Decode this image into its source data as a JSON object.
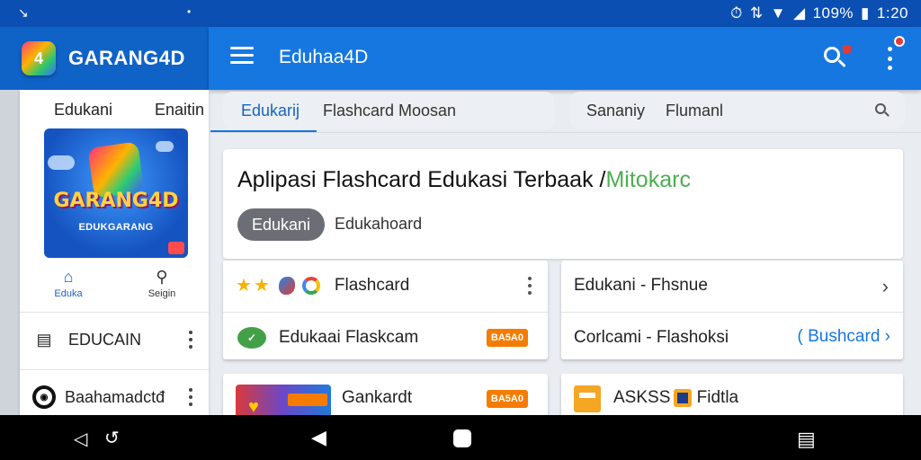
{
  "status_bar": {
    "left_glyph": "↘",
    "center_glyph": "•",
    "battery": "109%",
    "time": "1:20"
  },
  "brand": {
    "name": "GARANG4D"
  },
  "appbar": {
    "title": "Eduhaa4D"
  },
  "left_panel": {
    "tabs": [
      "Edukani",
      "Enaitin"
    ],
    "hero": {
      "title": "GARANG4D",
      "subtitle": "EDUKGARANG"
    },
    "nav": [
      {
        "label": "Eduka",
        "icon": "home-icon"
      },
      {
        "label": "Seigin",
        "icon": "search-icon"
      }
    ],
    "items": [
      {
        "label": "EDUCAIN",
        "icon": "screen-icon"
      },
      {
        "label": "Baahamadctđ",
        "icon": "ring-icon"
      }
    ]
  },
  "tabs": {
    "active": "Edukarij",
    "second": "Flashcard Moosan"
  },
  "filter": {
    "a": "Sananiy",
    "b": "Flumanl"
  },
  "headline": {
    "title": "Aplipasi Flashcard Edukasi Terbaak /",
    "accent": "Μitokarc",
    "chip": "Edukani",
    "chip_secondary": "Edukahoard"
  },
  "cards": [
    {
      "label": "Flashcard",
      "icons": [
        "star-icon",
        "star-icon",
        "blob-icon",
        "ring-color-icon"
      ]
    },
    {
      "label": "Edukaai Flaskcam",
      "badge": "BA5A0",
      "icon": "leaf-icon"
    },
    {
      "label": "Edukani - Fhsnue",
      "icon": "chevron-right-icon"
    },
    {
      "label": "Corlcami - Flashoksi",
      "link": "( Bushcard"
    },
    {
      "label": "Gankardt",
      "badge": "BA5A0",
      "icon": "thumbnail-icon"
    },
    {
      "label": "ASKSS",
      "label2": "Fidtla",
      "icon": "box-icon"
    }
  ],
  "colors": {
    "statusbar": "#0b4fb3",
    "appbar_left": "#0f63c7",
    "appbar_main": "#1677e0",
    "accent_green": "#4caf50",
    "badge_orange": "#f57c00"
  }
}
